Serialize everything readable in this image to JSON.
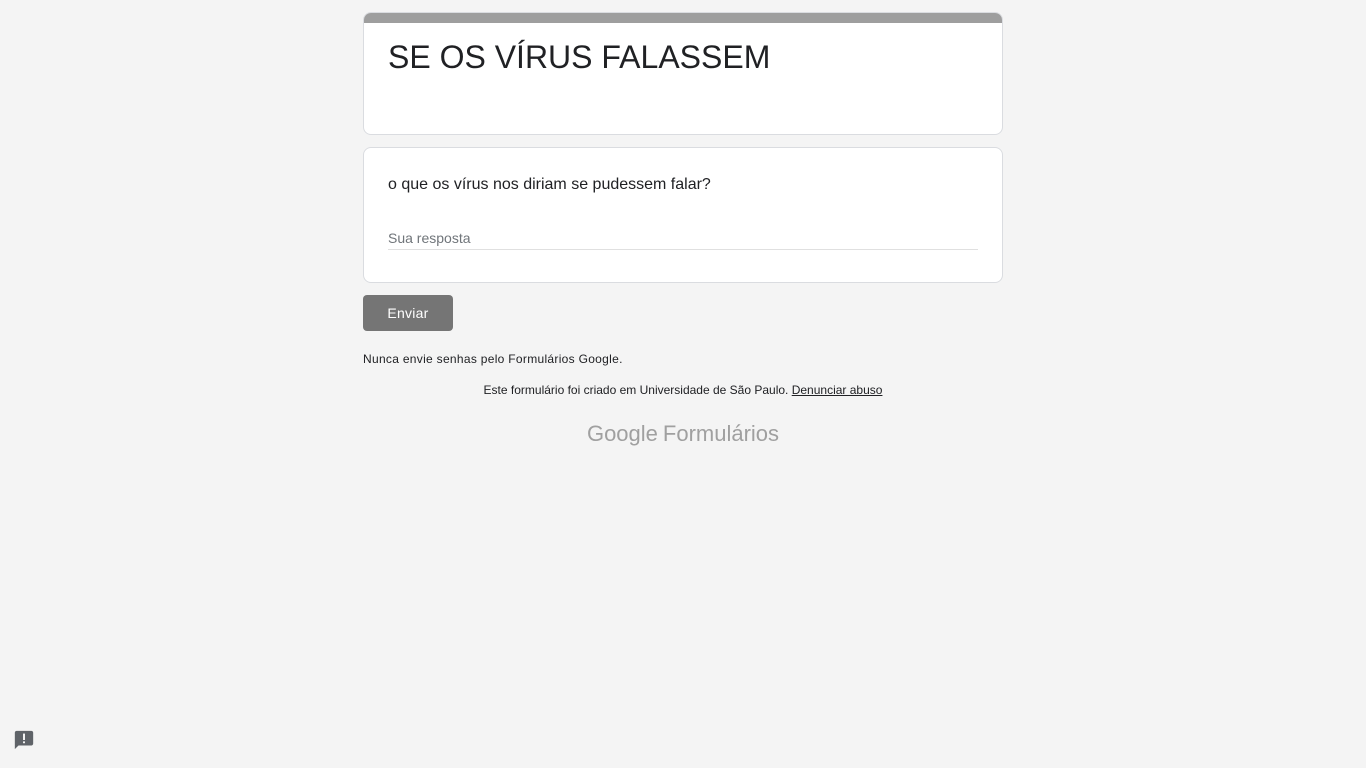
{
  "form": {
    "title": "SE OS VÍRUS FALASSEM",
    "question": "o que os vírus nos diriam se pudessem falar?",
    "answer_placeholder": "Sua resposta",
    "answer_value": "",
    "submit_label": "Enviar"
  },
  "footer": {
    "warning": "Nunca envie senhas pelo Formulários Google.",
    "created_in": "Este formulário foi criado em Universidade de São Paulo.",
    "report_link": "Denunciar abuso",
    "brand_google": "Google",
    "brand_product": "Formulários"
  },
  "icons": {
    "report": "report-problem-icon"
  },
  "colors": {
    "accent_bar": "#9e9e9e",
    "submit_button": "#757575",
    "background": "#f4f4f4"
  }
}
